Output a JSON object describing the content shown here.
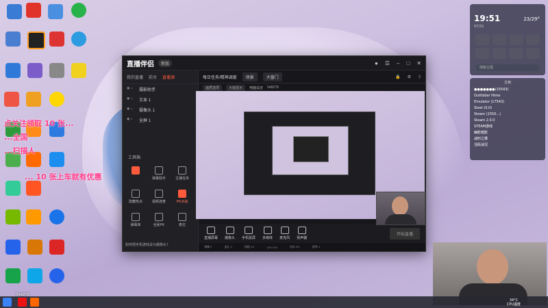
{
  "app": {
    "logo": "直播伴侣",
    "version": "新版",
    "left_tabs": [
      "我的直播",
      "前台",
      "直播源"
    ],
    "sources": [
      "摄影助手",
      "文本 1",
      "摄像头 1",
      "全屏 1"
    ],
    "tools_label": "工具箱",
    "tools": [
      "",
      "弹幕助手",
      "主播任务",
      "隐藏热点",
      "视频连麦",
      "PK对战",
      "弹幕库",
      "全民PK",
      "麦位"
    ],
    "bottom_tip": "如何把手机游戏设为摄像头？"
  },
  "scene": {
    "title": "每日任务/精神调度",
    "tab": "场景",
    "scene_name": "大窗门",
    "sub_items": [
      "画质选项",
      "大窗显示",
      "电脑设定",
      "548278"
    ]
  },
  "toolbar": {
    "buttons": [
      "直播屏幕",
      "摄像头",
      "手机投屏",
      "多媒体",
      "麦克风",
      "扬声器"
    ],
    "start_label": "开始直播"
  },
  "status_bar": [
    "弹幕 0",
    "送礼 0",
    "网络 0.0",
    "CPU 0%",
    "内存 0%",
    "帧率 0"
  ],
  "promo": {
    "line1": "点关注领取 10 张...",
    "line2": "...全国",
    "line3": "...扫描人",
    "line4": "... 10 张上车就有优惠"
  },
  "widget": {
    "time": "19:51",
    "date": "07/31",
    "weather": "23/29°",
    "search_placeholder": "搜索主题",
    "file_title": "文档",
    "files": [
      "●●●●●●●(15543)",
      "Outfolder Hime",
      "Emulator (17543)",
      "Steel (0.0)",
      "Steam (1550...)",
      "Steam 2.0.0",
      "STEAM游戏",
      "幽影暗影",
      "战时之赛",
      "活跃战况"
    ]
  },
  "desktop": {
    "live_id": "548278",
    "tray_temp": "34°C",
    "tray_cpu": "CPU温度"
  },
  "colors": {
    "accent": "#ff5a3c",
    "promo": "#ff3c8c"
  }
}
